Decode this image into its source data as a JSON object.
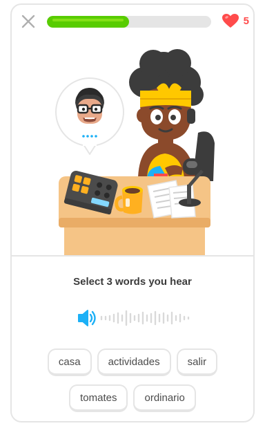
{
  "header": {
    "close_icon": "close-x-icon",
    "progress": 0.5,
    "hearts_icon": "heart-icon",
    "hearts_count": "5"
  },
  "exercise": {
    "prompt": "Select 3 words you hear",
    "speaker_icon": "speaker-icon"
  },
  "word_bank": {
    "row1": [
      "casa",
      "actividades",
      "salir"
    ],
    "row2": [
      "tomates",
      "ordinario"
    ]
  },
  "colors": {
    "accent_green": "#58cc02",
    "heart_red": "#ff4b4b",
    "speaker_blue": "#1cb0f6",
    "border": "#e5e5e5"
  }
}
